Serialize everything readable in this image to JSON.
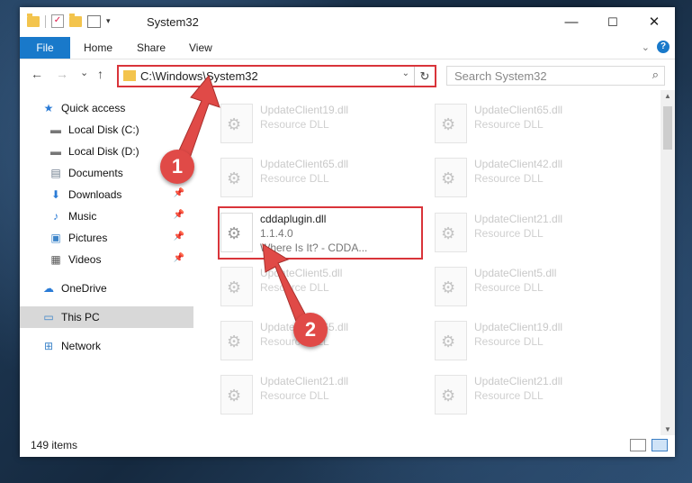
{
  "window": {
    "title": "System32",
    "minimize": "—",
    "maximize": "☐",
    "close": "✕"
  },
  "ribbon": {
    "tabs": [
      "File",
      "Home",
      "Share",
      "View"
    ]
  },
  "nav": {
    "back": "←",
    "forward": "→",
    "recent": "⌄",
    "up": "↑",
    "address": "C:\\Windows\\System32",
    "search_placeholder": "Search System32"
  },
  "sidebar": {
    "items": [
      {
        "label": "Quick access",
        "icon": "star-icon",
        "pinned": false
      },
      {
        "label": "Local Disk (C:)",
        "icon": "drive-icon",
        "pinned": false
      },
      {
        "label": "Local Disk (D:)",
        "icon": "drive-icon",
        "pinned": false
      },
      {
        "label": "Documents",
        "icon": "documents-icon",
        "pinned": true
      },
      {
        "label": "Downloads",
        "icon": "downloads-icon",
        "pinned": true
      },
      {
        "label": "Music",
        "icon": "music-icon",
        "pinned": true
      },
      {
        "label": "Pictures",
        "icon": "pictures-icon",
        "pinned": true
      },
      {
        "label": "Videos",
        "icon": "videos-icon",
        "pinned": true
      },
      {
        "label": "OneDrive",
        "icon": "cloud-icon",
        "pinned": false
      },
      {
        "label": "This PC",
        "icon": "computer-icon",
        "pinned": false,
        "selected": true
      },
      {
        "label": "Network",
        "icon": "network-icon",
        "pinned": false
      }
    ]
  },
  "files": {
    "left": [
      {
        "name": "UpdateClient19.dll",
        "type": "Resource DLL"
      },
      {
        "name": "UpdateClient65.dll",
        "type": "Resource DLL"
      },
      {
        "name": "cddaplugin.dll",
        "version": "1.1.4.0",
        "desc": "Where Is It? - CDDA..."
      },
      {
        "name": "UpdateClient5.dll",
        "type": "Resource DLL"
      },
      {
        "name": "UpdateClient65.dll",
        "type": "Resource DLL"
      },
      {
        "name": "UpdateClient21.dll",
        "type": "Resource DLL"
      }
    ],
    "right": [
      {
        "name": "UpdateClient65.dll",
        "type": "Resource DLL"
      },
      {
        "name": "UpdateClient42.dll",
        "type": "Resource DLL"
      },
      {
        "name": "UpdateClient21.dll",
        "type": "Resource DLL"
      },
      {
        "name": "UpdateClient5.dll",
        "type": "Resource DLL"
      },
      {
        "name": "UpdateClient19.dll",
        "type": "Resource DLL"
      },
      {
        "name": "UpdateClient21.dll",
        "type": "Resource DLL"
      }
    ]
  },
  "status": {
    "items": "149 items"
  },
  "annotations": {
    "step1": "1",
    "step2": "2",
    "color": "#e04a47"
  }
}
